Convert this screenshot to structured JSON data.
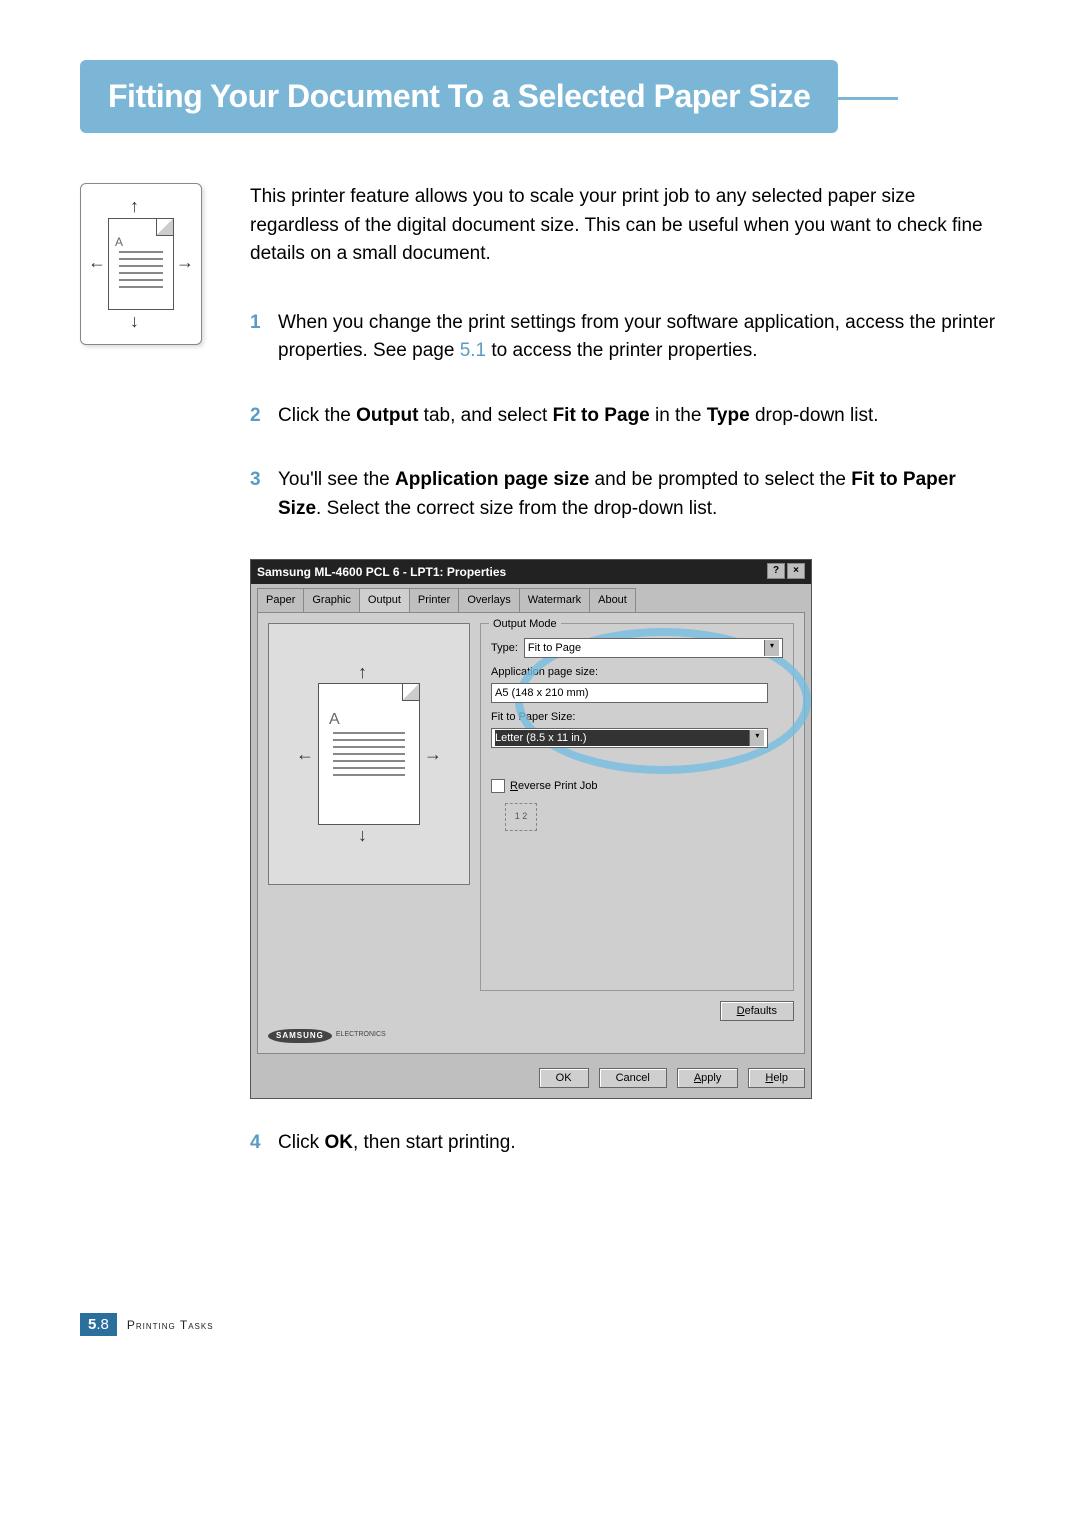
{
  "title": "Fitting Your Document To a Selected Paper Size",
  "intro": "This printer feature allows you to scale your print job to any selected paper size regardless of the digital document size. This can be useful when you want to check fine details on a small document.",
  "page_letter": "A",
  "steps": {
    "s1": {
      "num": "1",
      "pre": "When you change the print settings from your software application, access the printer properties. See page ",
      "link": "5.1",
      "post": " to access the printer properties."
    },
    "s2": {
      "num": "2",
      "p1": "Click the ",
      "b1": "Output",
      "p2": " tab, and select ",
      "b2": "Fit to Page",
      "p3": " in the ",
      "b3": "Type",
      "p4": " drop-down list."
    },
    "s3": {
      "num": "3",
      "p1": "You'll see the ",
      "b1": "Application page size",
      "p2": " and be prompted to select the ",
      "b2": "Fit to Paper Size",
      "p3": ". Select the correct size from the drop-down list."
    },
    "s4": {
      "num": "4",
      "p1": "Click ",
      "b1": "OK",
      "p2": ", then start printing."
    }
  },
  "dialog": {
    "title_text": "Samsung ML-4600 PCL 6 - LPT1: Properties",
    "help_glyph": "?",
    "close_glyph": "×",
    "tabs": {
      "paper": "Paper",
      "graphic": "Graphic",
      "output": "Output",
      "printer": "Printer",
      "overlays": "Overlays",
      "watermark": "Watermark",
      "about": "About"
    },
    "group_title": "Output Mode",
    "type_label": "Type:",
    "type_value": "Fit to Page",
    "app_size_label": "Application page size:",
    "app_size_value": "A5 (148 x 210 mm)",
    "fit_size_label": "Fit to Paper Size:",
    "fit_size_value": "Letter (8.5 x 11 in.)",
    "reverse_label": "Reverse Print Job",
    "reverse_first": "R",
    "defaults": "Defaults",
    "defaults_first": "D",
    "brand": "SAMSUNG",
    "brand_sub": "ELECTRONICS",
    "ok": "OK",
    "cancel": "Cancel",
    "apply": "Apply",
    "apply_first": "A",
    "help_btn": "Help",
    "help_first": "H",
    "combo_glyph": "▾"
  },
  "footer": {
    "page_major": "5",
    "page_dot": ".",
    "page_minor": "8",
    "section": "Printing Tasks"
  }
}
